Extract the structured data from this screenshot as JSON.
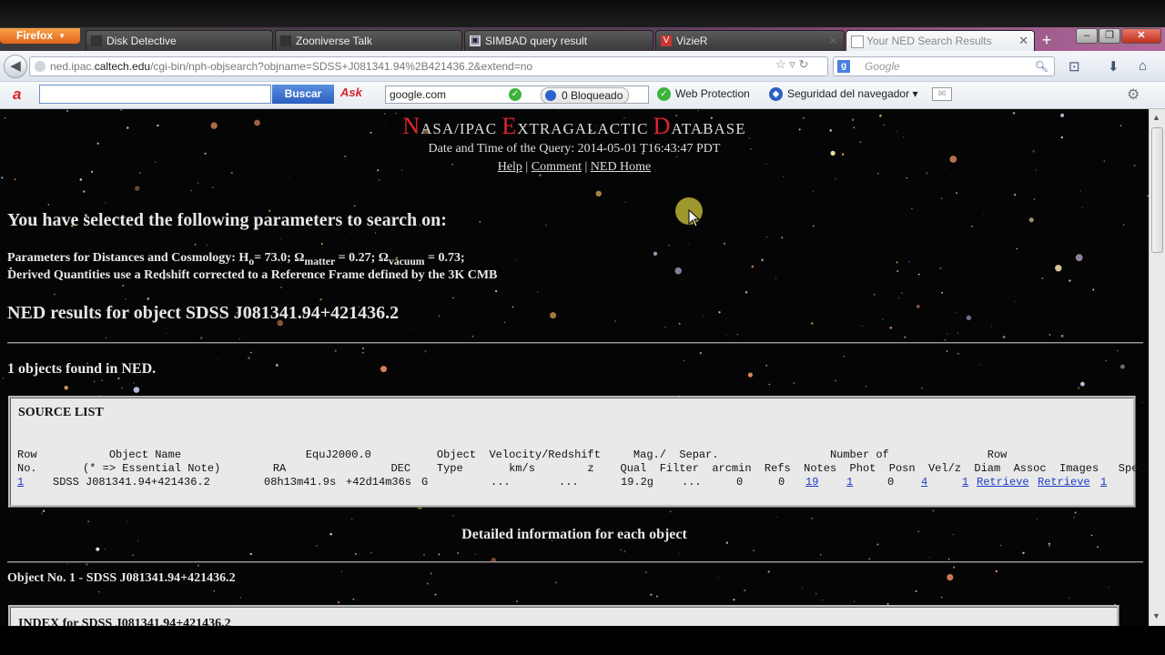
{
  "browser": {
    "firefox_label": "Firefox",
    "tabs": [
      {
        "label": "Disk Detective"
      },
      {
        "label": "Zooniverse Talk"
      },
      {
        "label": "SIMBAD query result"
      },
      {
        "label": "VizieR"
      },
      {
        "label": "Your NED Search Results"
      }
    ],
    "new_tab": "+",
    "url_prefix": "ned.ipac.",
    "url_domain": "caltech.edu",
    "url_path": "/cgi-bin/nph-objsearch?objname=SDSS+J081341.94%2B421436.2&extend=no",
    "search_placeholder": "Google"
  },
  "ask_toolbar": {
    "search_button": "Buscar",
    "ask_label": "Ask",
    "google_field": "google.com",
    "blocked": "0 Bloqueado",
    "web_protection": "Web Protection",
    "browser_security": "Seguridad del navegador"
  },
  "page": {
    "title_caps": [
      "N",
      "E",
      "D"
    ],
    "title_rest": [
      "ASA/IPAC ",
      "XTRAGALACTIC ",
      "ATABASE"
    ],
    "query_date": "Date and Time of the Query: 2014-05-01 T16:43:47 PDT",
    "links": [
      "Help",
      "Comment",
      "NED Home"
    ],
    "params_heading": "You have selected the following parameters to search on:",
    "cosmo_h0_prefix": "Parameters for Distances and Cosmology: H",
    "cosmo_h0_sub": "o",
    "cosmo_h0_rest": "= 73.0; Ω",
    "cosmo_matter_sub": "matter",
    "cosmo_matter_rest": " = 0.27; Ω",
    "cosmo_vacuum_sub": "vacuum",
    "cosmo_vacuum_rest": " = 0.73;",
    "derived_line": "Derived Quantities use a Redshift corrected to a Reference Frame defined by the 3K CMB",
    "results_heading": "NED results for object SDSS J081341.94+421436.2",
    "found_text": "1 objects found in NED.",
    "source_list": {
      "title": "SOURCE LIST",
      "header_line1": "Row           Object Name                   EquJ2000.0          Object  Velocity/Redshift     Mag./  Separ.                 Number of               Row",
      "header_line2": "No.       (* => Essential Note)        RA                DEC    Type       km/s        z    Qual  Filter  arcmin  Refs  Notes  Phot  Posn  Vel/z  Diam  Assoc  Images   Spectra  No.",
      "row": {
        "row_no": "1",
        "name": "SDSS J081341.94+421436.2",
        "ra": "08h13m41.9s",
        "dec": "+42d14m36s",
        "type": "G",
        "velocity": "...",
        "z": "...",
        "mag": "19.2g",
        "separ": "...",
        "refs": "0",
        "notes": "0",
        "phot": "19",
        "posn": "1",
        "velz": "0",
        "diam": "4",
        "assoc": "1",
        "images": "Retrieve",
        "spectra": "Retrieve",
        "row_no_end": "1"
      }
    },
    "detail_heading": "Detailed information for each object",
    "object_line": "Object No. 1 - SDSS J081341.94+421436.2",
    "index_title": "INDEX for SDSS J081341.94+421436.2"
  },
  "colors": {
    "ned_red": "#e0262e",
    "link_blue": "#1a3cc8",
    "panel_gray": "#e9e9e9"
  }
}
